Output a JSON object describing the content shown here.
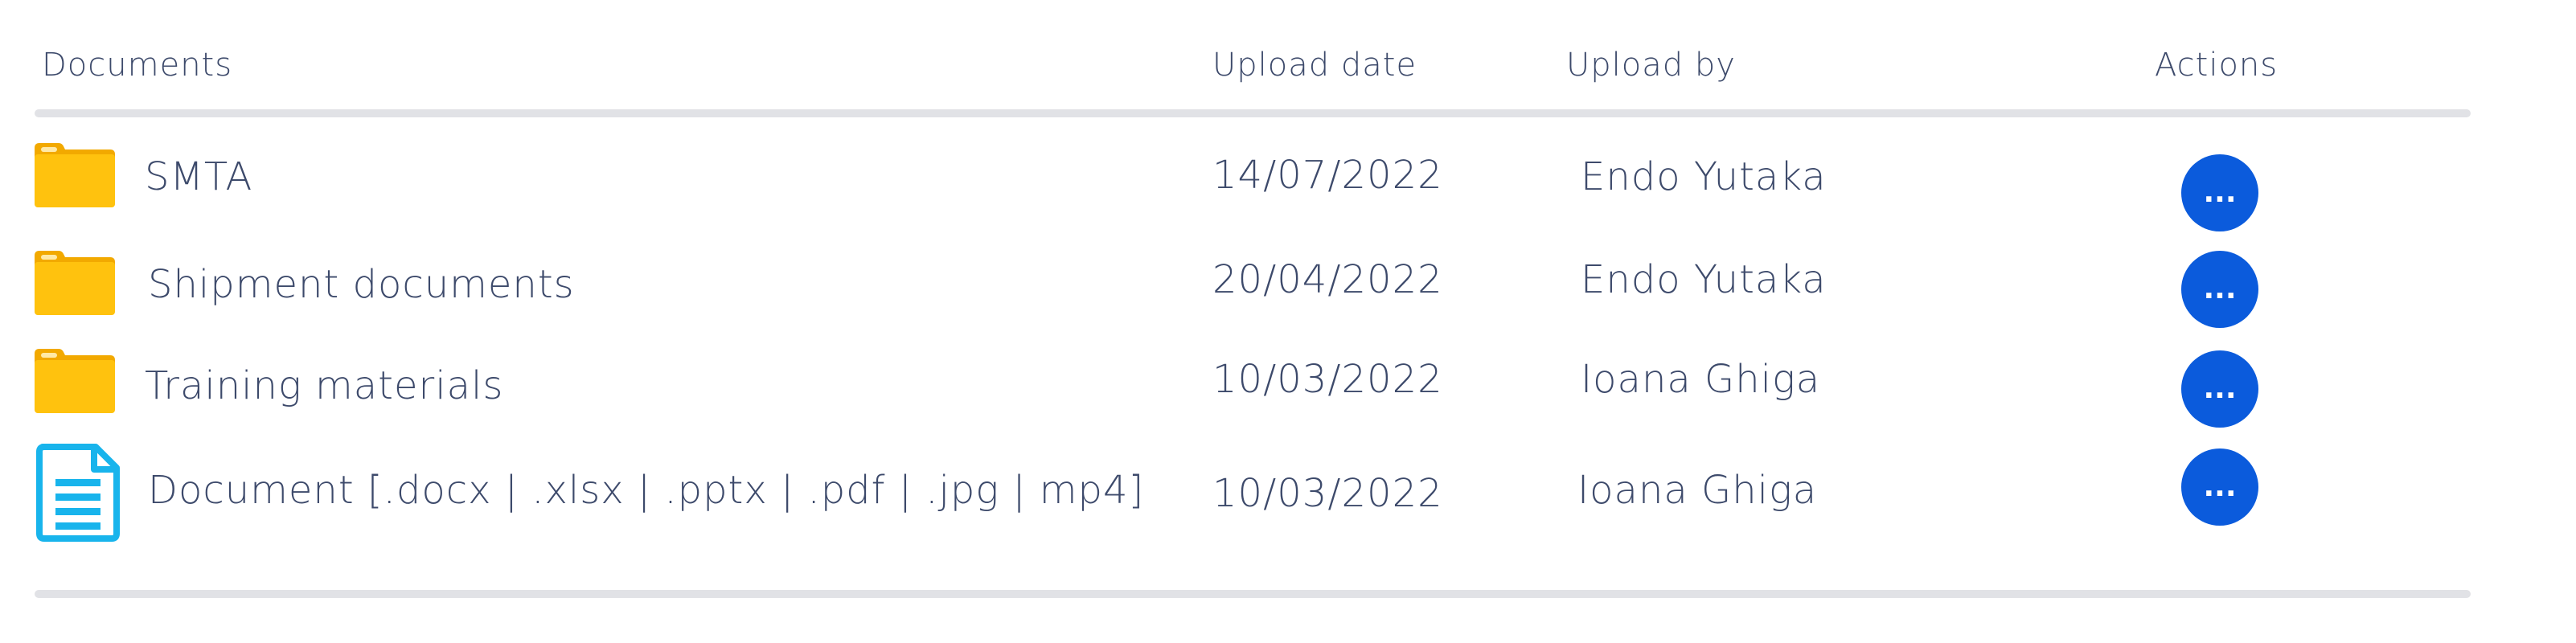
{
  "table": {
    "headers": {
      "documents": "Documents",
      "upload_date": "Upload date",
      "upload_by": "Upload by",
      "actions": "Actions"
    },
    "rows": [
      {
        "name": "SMTA",
        "date": "14/07/2022",
        "by": "Endo Yutaka",
        "icon": "folder-icon",
        "action": "..."
      },
      {
        "name": "Shipment documents",
        "date": "20/04/2022",
        "by": "Endo Yutaka",
        "icon": "folder-icon",
        "action": "..."
      },
      {
        "name": "Training materials",
        "date": "10/03/2022",
        "by": "Ioana Ghiga",
        "icon": "folder-icon",
        "action": "..."
      },
      {
        "name": "Document [.docx | .xlsx | .pptx | .pdf | .jpg | mp4]",
        "date": "10/03/2022",
        "by": "Ioana Ghiga",
        "icon": "document-icon",
        "action": "..."
      }
    ]
  },
  "colors": {
    "text": "#3d4a6b",
    "divider": "#e1e2e6",
    "folder": "#ffc20e",
    "document": "#18b4ec",
    "action_button": "#0b5bdc"
  }
}
